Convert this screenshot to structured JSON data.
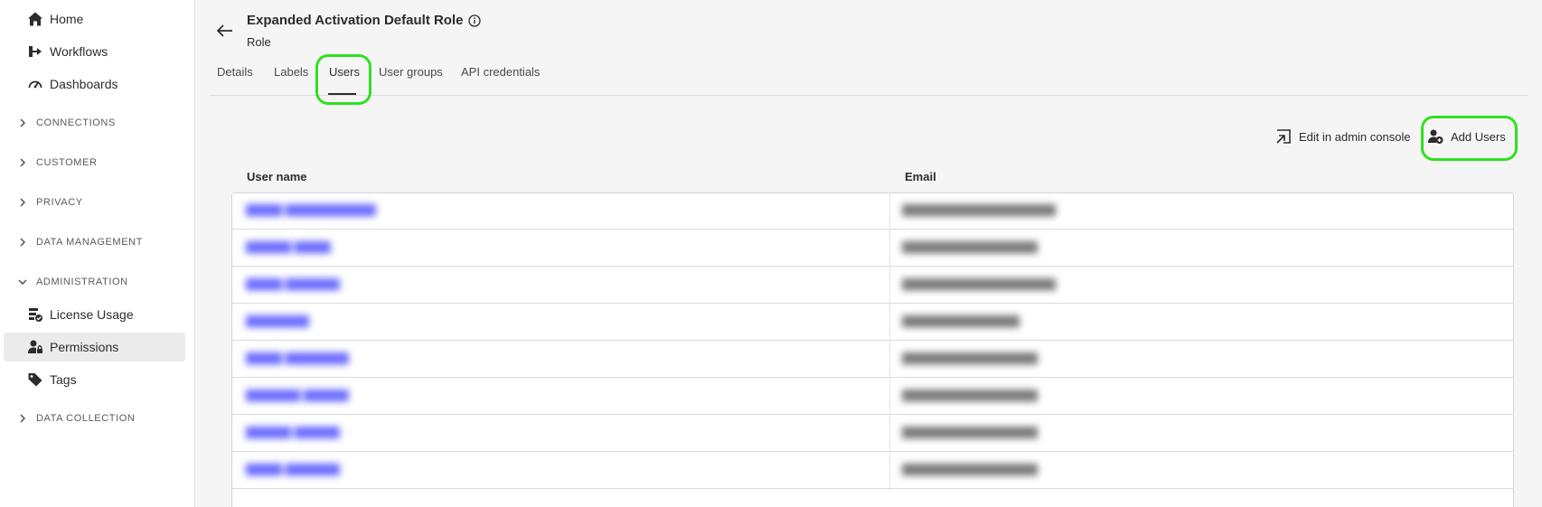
{
  "sidebar": {
    "items": [
      {
        "label": "Home",
        "icon": "home-icon"
      },
      {
        "label": "Workflows",
        "icon": "workflow-icon"
      },
      {
        "label": "Dashboards",
        "icon": "dashboard-icon"
      }
    ],
    "sections": [
      {
        "label": "CONNECTIONS",
        "expanded": false
      },
      {
        "label": "CUSTOMER",
        "expanded": false
      },
      {
        "label": "PRIVACY",
        "expanded": false
      },
      {
        "label": "DATA MANAGEMENT",
        "expanded": false
      },
      {
        "label": "ADMINISTRATION",
        "expanded": true
      },
      {
        "label": "DATA COLLECTION",
        "expanded": false
      }
    ],
    "admin_items": [
      {
        "label": "License Usage",
        "icon": "license-icon"
      },
      {
        "label": "Permissions",
        "icon": "permissions-icon",
        "active": true
      },
      {
        "label": "Tags",
        "icon": "tag-icon"
      }
    ]
  },
  "header": {
    "title": "Expanded Activation Default Role",
    "subtitle": "Role"
  },
  "tabs": [
    {
      "label": "Details"
    },
    {
      "label": "Labels"
    },
    {
      "label": "Users",
      "active": true
    },
    {
      "label": "User groups"
    },
    {
      "label": "API credentials"
    }
  ],
  "actions": {
    "edit_label": "Edit in admin console",
    "add_label": "Add Users"
  },
  "table": {
    "columns": [
      "User name",
      "Email"
    ],
    "rows": [
      {
        "name": "▇▇▇▇ ▇▇▇▇▇▇▇▇▇▇",
        "email": "▇▇▇▇▇▇▇▇▇▇▇▇▇▇▇▇▇"
      },
      {
        "name": "▇▇▇▇▇ ▇▇▇▇",
        "email": "▇▇▇▇▇▇▇▇▇▇▇▇▇▇▇"
      },
      {
        "name": "▇▇▇▇ ▇▇▇▇▇▇",
        "email": "▇▇▇▇▇▇▇▇▇▇▇▇▇▇▇▇▇"
      },
      {
        "name": "▇▇▇▇▇▇▇",
        "email": "▇▇▇▇▇▇▇▇▇▇▇▇▇"
      },
      {
        "name": "▇▇▇▇ ▇▇▇▇▇▇▇",
        "email": "▇▇▇▇▇▇▇▇▇▇▇▇▇▇▇"
      },
      {
        "name": "▇▇▇▇▇▇ ▇▇▇▇▇",
        "email": "▇▇▇▇▇▇▇▇▇▇▇▇▇▇▇"
      },
      {
        "name": "▇▇▇▇▇ ▇▇▇▇▇",
        "email": "▇▇▇▇▇▇▇▇▇▇▇▇▇▇▇"
      },
      {
        "name": "▇▇▇▇ ▇▇▇▇▇▇",
        "email": "▇▇▇▇▇▇▇▇▇▇▇▇▇▇▇"
      }
    ]
  },
  "colors": {
    "highlight": "#2fe21e",
    "link": "#6b6bff",
    "active_bg": "#ebebeb"
  }
}
